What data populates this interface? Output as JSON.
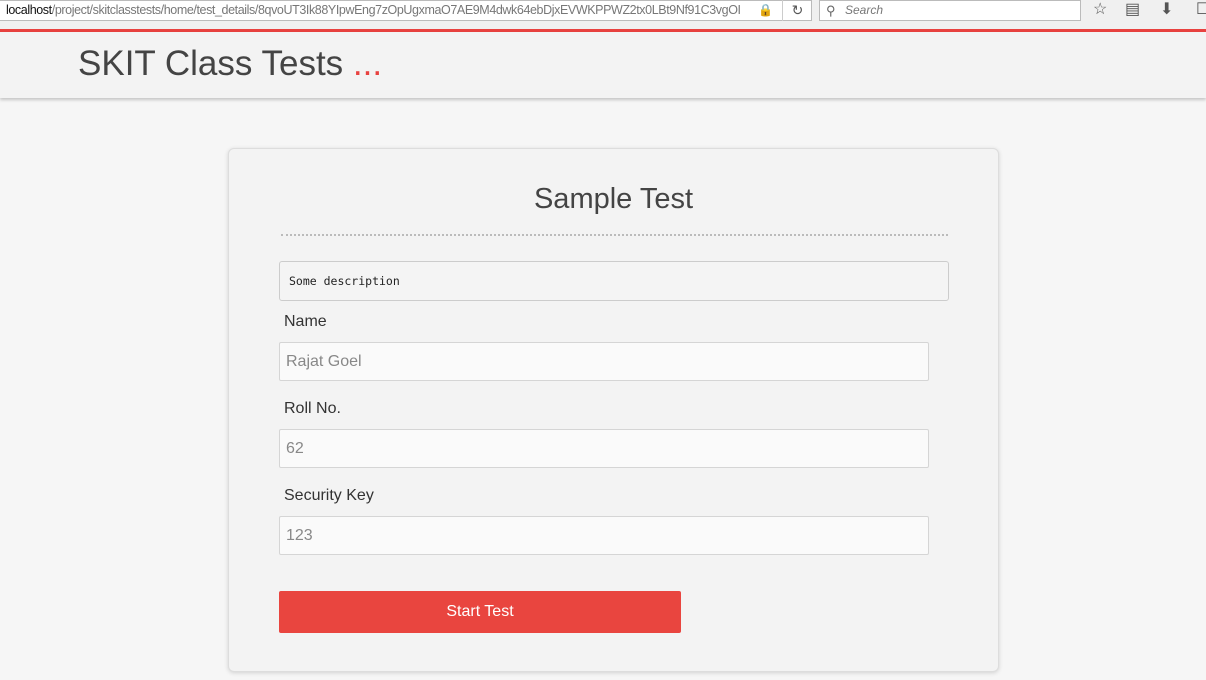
{
  "browser": {
    "url_host": "localhost",
    "url_path": "/project/skitclasstests/home/test_details/8qvoUT3Ik88YIpwEng7zOpUgxmaO7AE9M4dwk64ebDjxEVWKPPWZ2tx0LBt9Nf91C3vgOI",
    "search_placeholder": "Search"
  },
  "header": {
    "brand": "SKIT Class Tests",
    "brand_dots": "...",
    "accent_color": "#e8413f"
  },
  "card": {
    "title": "Sample Test",
    "description": "Some description",
    "fields": [
      {
        "label": "Name",
        "value": "Rajat Goel"
      },
      {
        "label": "Roll No.",
        "value": "62"
      },
      {
        "label": "Security Key",
        "value": "123"
      }
    ],
    "submit_label": "Start Test"
  }
}
